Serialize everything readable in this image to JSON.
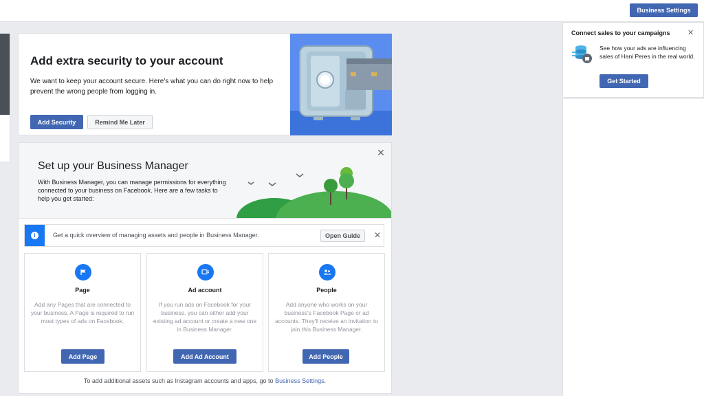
{
  "topbar": {
    "business_settings": "Business Settings"
  },
  "security": {
    "title": "Add extra security to your account",
    "body": "We want to keep your account secure. Here's what you can do right now to help prevent the wrong people from logging in.",
    "add_button": "Add Security",
    "later_button": "Remind Me Later"
  },
  "business_manager": {
    "title": "Set up your Business Manager",
    "body": "With Business Manager, you can manage permissions for everything connected to your business on Facebook. Here are a few tasks to help you get started:",
    "close": "✕",
    "guide": {
      "icon": "info-icon",
      "text": "Get a quick overview of managing assets and people in Business Manager.",
      "button": "Open Guide",
      "close": "✕"
    },
    "cards": [
      {
        "icon": "flag-icon",
        "title": "Page",
        "desc": "Add any Pages that are connected to your business. A Page is required to run most types of ads on Facebook.",
        "button": "Add Page"
      },
      {
        "icon": "ad-account-icon",
        "title": "Ad account",
        "desc": "If you run ads on Facebook for your business, you can either add your existing ad account or create a new one in Business Manager.",
        "button": "Add Ad Account"
      },
      {
        "icon": "people-icon",
        "title": "People",
        "desc": "Add anyone who works on your business's Facebook Page or ad accounts. They'll receive an invitation to join this Business Manager.",
        "button": "Add People"
      }
    ],
    "footer_text": "To add additional assets such as Instagram accounts and apps, go to ",
    "footer_link": "Business Settings",
    "footer_end": "."
  },
  "connect_sales": {
    "title": "Connect sales to your campaigns",
    "close": "✕",
    "body": "See how your ads are influencing sales of Hani Peres in the real world.",
    "button": "Get Started"
  },
  "colors": {
    "accent": "#4267b2",
    "info_blue": "#1877f2",
    "page_bg": "#e9ebee"
  }
}
